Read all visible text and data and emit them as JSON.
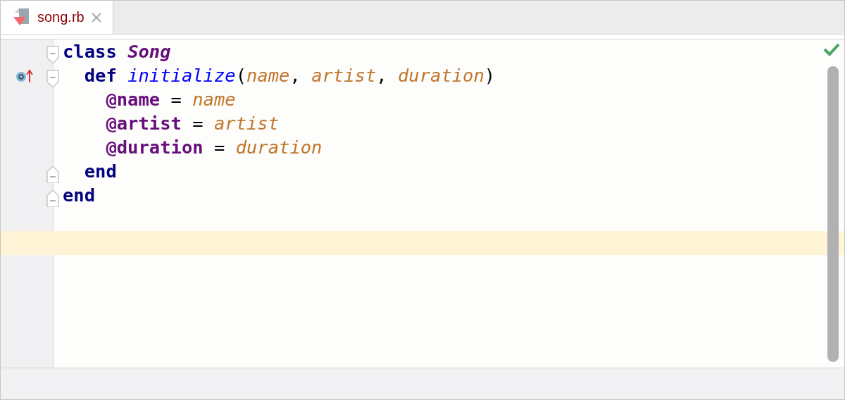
{
  "tabs": [
    {
      "label": "song.rb",
      "selected": true
    }
  ],
  "editor": {
    "inspection_ok": true,
    "lines": [
      {
        "kind": "opener",
        "gutter_mark": false,
        "current": false,
        "tokens": [
          {
            "text": "class ",
            "kind": "keyword"
          },
          {
            "text": "Song",
            "kind": "class"
          }
        ]
      },
      {
        "kind": "opener",
        "gutter_mark": true,
        "current": false,
        "tokens": [
          {
            "text": "  def ",
            "kind": "keyword"
          },
          {
            "text": "initialize",
            "kind": "method"
          },
          {
            "text": "(",
            "kind": "plain"
          },
          {
            "text": "name",
            "kind": "param"
          },
          {
            "text": ", ",
            "kind": "plain"
          },
          {
            "text": "artist",
            "kind": "param"
          },
          {
            "text": ", ",
            "kind": "plain"
          },
          {
            "text": "duration",
            "kind": "param"
          },
          {
            "text": ")",
            "kind": "plain"
          }
        ]
      },
      {
        "kind": "plain",
        "gutter_mark": false,
        "current": false,
        "tokens": [
          {
            "text": "    @name",
            "kind": "ivar"
          },
          {
            "text": " = ",
            "kind": "plain"
          },
          {
            "text": "name",
            "kind": "param"
          }
        ]
      },
      {
        "kind": "plain",
        "gutter_mark": false,
        "current": false,
        "tokens": [
          {
            "text": "    @artist",
            "kind": "ivar"
          },
          {
            "text": " = ",
            "kind": "plain"
          },
          {
            "text": "artist",
            "kind": "param"
          }
        ]
      },
      {
        "kind": "plain",
        "gutter_mark": false,
        "current": false,
        "tokens": [
          {
            "text": "    @duration",
            "kind": "ivar"
          },
          {
            "text": " = ",
            "kind": "plain"
          },
          {
            "text": "duration",
            "kind": "param"
          }
        ]
      },
      {
        "kind": "closer",
        "gutter_mark": false,
        "current": false,
        "tokens": [
          {
            "text": "  end",
            "kind": "keyword"
          }
        ]
      },
      {
        "kind": "closer",
        "gutter_mark": false,
        "current": false,
        "tokens": [
          {
            "text": "end",
            "kind": "keyword"
          }
        ]
      },
      {
        "kind": "plain",
        "gutter_mark": false,
        "current": false
      },
      {
        "kind": "plain",
        "gutter_mark": false,
        "current": true
      }
    ]
  }
}
